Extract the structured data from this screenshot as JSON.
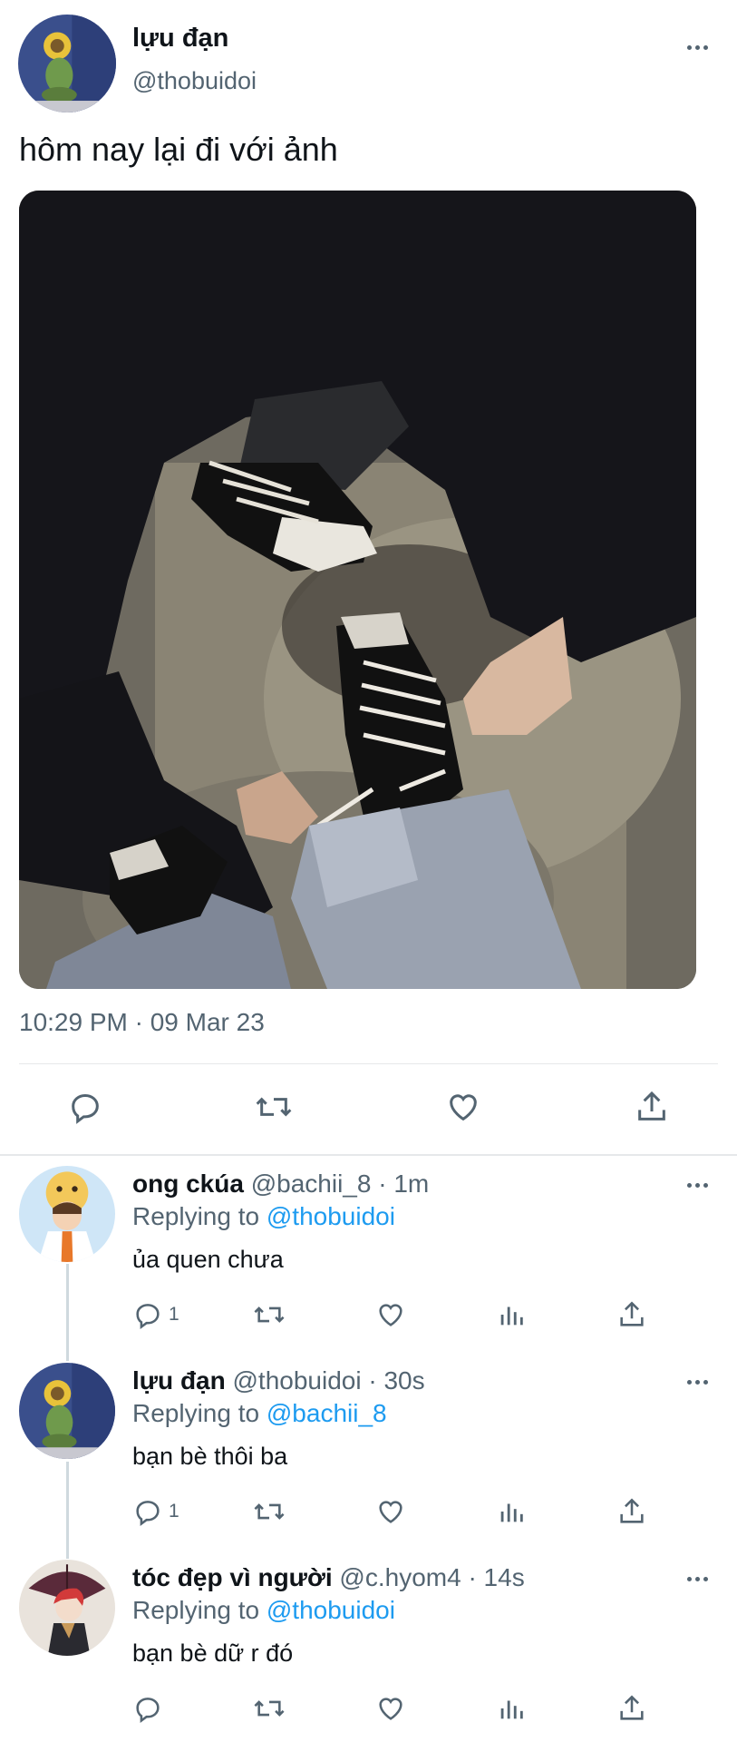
{
  "tweet": {
    "author_name": "lựu đạn",
    "author_handle": "@thobuidoi",
    "text": "hôm nay lại đi với ảnh",
    "timestamp": "10:29 PM · 09 Mar 23",
    "photo_alt": "photo-of-sneakers"
  },
  "replies": [
    {
      "name": "ong ckúa",
      "meta": "@bachii_8 · 1m",
      "replying_label": "Replying to",
      "replying_to": "@thobuidoi",
      "text": "ủa quen chưa",
      "reply_count": "1"
    },
    {
      "name": "lựu đạn",
      "meta": "@thobuidoi · 30s",
      "replying_label": "Replying to",
      "replying_to": "@bachii_8",
      "text": "bạn bè thôi ba",
      "reply_count": "1"
    },
    {
      "name": "tóc đẹp vì người",
      "meta": "@c.hyom4 · 14s",
      "replying_label": "Replying to",
      "replying_to": "@thobuidoi",
      "text": "bạn bè dữ r đó",
      "reply_count": ""
    }
  ],
  "colors": {
    "accent": "#1d9bf0",
    "muted": "#536471",
    "text": "#0f1419"
  },
  "icons": [
    "more-icon",
    "reply-icon",
    "retweet-icon",
    "like-icon",
    "analytics-icon",
    "share-icon"
  ]
}
